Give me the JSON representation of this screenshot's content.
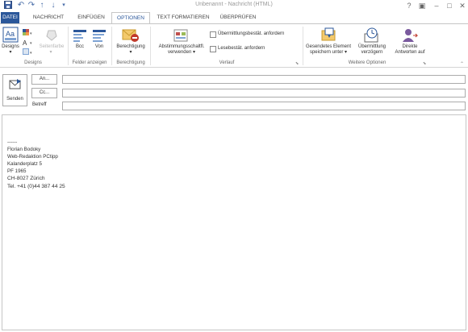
{
  "window": {
    "title": "Unbenannt - Nachricht (HTML)",
    "controls": [
      "?",
      "▣",
      "–",
      "□",
      "✕"
    ]
  },
  "tabs": [
    {
      "label": "DATEI"
    },
    {
      "label": "NACHRICHT"
    },
    {
      "label": "EINFÜGEN"
    },
    {
      "label": "OPTIONEN"
    },
    {
      "label": "TEXT FORMATIEREN"
    },
    {
      "label": "ÜBERPRÜFEN"
    }
  ],
  "ribbon": {
    "groups": {
      "designs": "Designs",
      "fields": "Felder anzeigen",
      "permission": "Berechtigung",
      "tracking": "Verlauf",
      "more": "Weitere Optionen"
    },
    "designs_button": "Designs",
    "page_color": "Seitenfarbe",
    "bcc": "Bcc",
    "from": "Von",
    "permission_button": "Berechtigung",
    "voting_line1": "Abstimmungsschaltfl.",
    "voting_line2": "verwenden",
    "delivery_receipt": "Übermittlungsbestät. anfordern",
    "read_receipt": "Lesebestät. anfordern",
    "save_sent_line1": "Gesendetes Element",
    "save_sent_line2": "speichern unter",
    "delay_line1": "Übermittlung",
    "delay_line2": "verzögern",
    "direct_line1": "Direkte",
    "direct_line2": "Antworten auf"
  },
  "header": {
    "send": "Senden",
    "to": "An...",
    "cc": "Cc...",
    "subject": "Betreff"
  },
  "signature": [
    "------",
    "Florian Bodoky",
    "Web-Redaktion PCtipp",
    "Kalanderplatz 5",
    "PF 1965",
    "CH-8027 Zürich",
    "Tel. +41 (0)44 387 44 25"
  ],
  "colors": {
    "accent": "#2b579a",
    "border": "#ababab"
  }
}
